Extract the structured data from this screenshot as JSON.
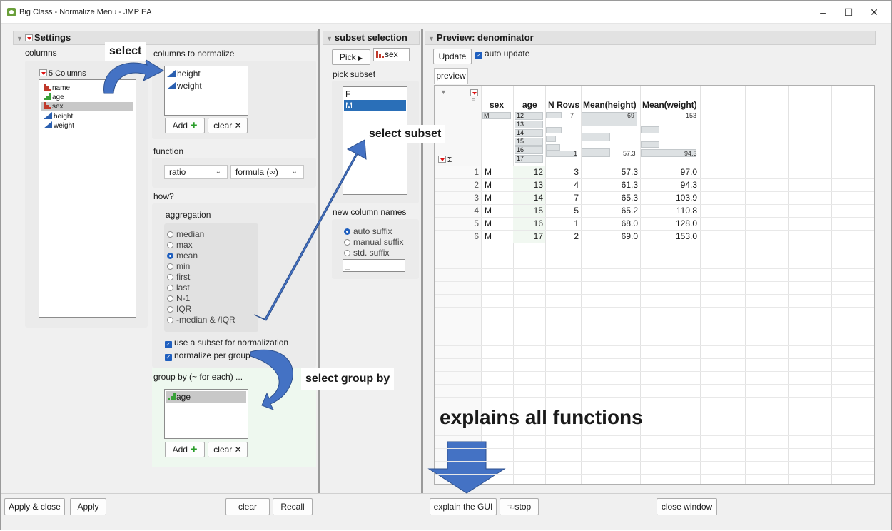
{
  "window": {
    "title": "Big Class - Normalize Menu - JMP EA",
    "minimize": "–",
    "maximize": "☐",
    "close": "✕"
  },
  "settings": {
    "header": "Settings",
    "columns_label": "columns",
    "columns_count": "5 Columns",
    "columns": [
      {
        "name": "name",
        "type": "nominal"
      },
      {
        "name": "age",
        "type": "ordinal"
      },
      {
        "name": "sex",
        "type": "nominal"
      },
      {
        "name": "height",
        "type": "continuous"
      },
      {
        "name": "weight",
        "type": "continuous"
      }
    ],
    "normalize_label": "columns to normalize",
    "normalize_items": [
      "height",
      "weight"
    ],
    "add_label": "Add",
    "clear_label": "clear",
    "function_label": "function",
    "function_value": "ratio",
    "formula_value": "formula (∞)",
    "how_label": "how?",
    "aggregation_label": "aggregation",
    "aggregations": [
      "median",
      "max",
      "mean",
      "min",
      "first",
      "last",
      "N-1",
      "IQR",
      "-median & /IQR"
    ],
    "aggregation_selected": "mean",
    "use_subset_label": "use a subset for normalization",
    "per_group_label": "normalize per group",
    "group_by_label": "group by (~ for each) ...",
    "group_by_items": [
      "age"
    ]
  },
  "subset": {
    "header": "subset selection",
    "pick_label": "Pick",
    "pick_value": "sex",
    "pick_subset_label": "pick subset",
    "subset_items": [
      "F",
      "M"
    ],
    "subset_selected": "M",
    "new_names_label": "new column names",
    "name_options": [
      "auto suffix",
      "manual suffix",
      "std. suffix"
    ],
    "name_selected": "auto suffix",
    "suffix_value": "_"
  },
  "preview": {
    "header": "Preview: denominator",
    "update_label": "Update",
    "auto_update_label": "auto update",
    "tab_label": "preview",
    "columns": [
      "sex",
      "age",
      "N Rows",
      "Mean(height)",
      "Mean(weight)"
    ],
    "summary": {
      "sex": "M",
      "age_levels": [
        "12",
        "13",
        "14",
        "15",
        "16",
        "17"
      ],
      "nrows_max": "7",
      "nrows_min": "1",
      "height_max": "69",
      "height_min": "57.3",
      "weight_max": "153",
      "weight_min": "94.3",
      "sigma": "Σ"
    },
    "rows": [
      [
        "1",
        "M",
        "12",
        "3",
        "57.3",
        "97.0"
      ],
      [
        "2",
        "M",
        "13",
        "4",
        "61.3",
        "94.3"
      ],
      [
        "3",
        "M",
        "14",
        "7",
        "65.3",
        "103.9"
      ],
      [
        "4",
        "M",
        "15",
        "5",
        "65.2",
        "110.8"
      ],
      [
        "5",
        "M",
        "16",
        "1",
        "68.0",
        "128.0"
      ],
      [
        "6",
        "M",
        "17",
        "2",
        "69.0",
        "153.0"
      ]
    ]
  },
  "footer": {
    "apply_close": "Apply & close",
    "apply": "Apply",
    "clear": "clear",
    "recall": "Recall",
    "explain": "explain the GUI",
    "stop": "stop",
    "close_window": "close window"
  },
  "annotations": {
    "select": "select",
    "select_subset": "select subset",
    "select_group_by": "select group by",
    "explains": "explains all functions"
  },
  "colors": {
    "accent": "#1f5fbf",
    "arrow": "#4472c4",
    "nominal": "#c0392b",
    "ordinal": "#3aa13a",
    "continuous": "#2a5fb0"
  }
}
